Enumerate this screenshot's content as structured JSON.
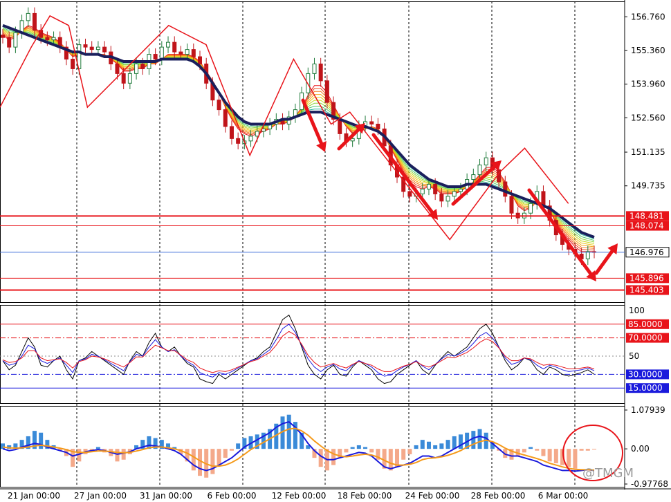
{
  "watermark": "@TMGM",
  "chart_data": {
    "type": "candlestick",
    "symbol": "",
    "x_labels": [
      "21 Jan 00:00",
      "27 Jan 00:00",
      "31 Jan 00:00",
      "6 Feb 00:00",
      "12 Feb 00:00",
      "18 Feb 00:00",
      "24 Feb 00:00",
      "28 Feb 00:00",
      "6 Mar 00:00"
    ],
    "price_panel": {
      "ylim": [
        144.9,
        157.4
      ],
      "tick_labels": [
        "156.760",
        "155.360",
        "153.960",
        "152.560",
        "151.135",
        "149.735"
      ],
      "tick_values": [
        156.76,
        155.36,
        153.96,
        152.56,
        151.135,
        149.735
      ],
      "levels": [
        {
          "label": "148.481",
          "value": 148.481,
          "color": "#e8141a",
          "thick": true
        },
        {
          "label": "148.074",
          "value": 148.074,
          "color": "#e8141a",
          "thick": false
        },
        {
          "label": "145.896",
          "value": 145.896,
          "color": "#e8141a",
          "thick": false
        },
        {
          "label": "145.403",
          "value": 145.403,
          "color": "#e8141a",
          "thick": true
        }
      ],
      "current_price": {
        "label": "146.976",
        "value": 146.976,
        "color": "#3f6fd8"
      },
      "close_series": [
        155.9,
        155.5,
        156.1,
        156.6,
        156.9,
        156.2,
        155.9,
        155.8,
        155.9,
        155.5,
        155.0,
        154.6,
        155.6,
        155.5,
        155.4,
        155.5,
        155.3,
        154.8,
        154.4,
        154.0,
        154.4,
        154.8,
        154.6,
        155.2,
        155.0,
        155.5,
        155.7,
        155.3,
        155.2,
        155.4,
        155.1,
        154.8,
        154.0,
        153.3,
        152.9,
        152.2,
        151.7,
        151.5,
        151.6,
        151.8,
        152.0,
        152.1,
        152.3,
        152.5,
        152.3,
        152.6,
        152.9,
        153.6,
        154.4,
        154.8,
        154.1,
        153.2,
        152.5,
        151.9,
        151.6,
        151.7,
        152.2,
        152.4,
        152.3,
        152.1,
        151.4,
        150.6,
        150.1,
        149.5,
        149.3,
        149.4,
        149.6,
        149.8,
        149.4,
        149.1,
        149.3,
        149.5,
        149.6,
        150.0,
        150.2,
        150.6,
        150.9,
        150.4,
        149.9,
        149.3,
        148.6,
        148.4,
        148.6,
        149.0,
        149.5,
        148.9,
        148.3,
        147.7,
        147.3,
        147.1,
        146.9,
        146.7,
        147.0,
        146.976
      ],
      "ema_fast": [
        156.0,
        155.8,
        155.9,
        156.2,
        156.4,
        156.3,
        156.1,
        156.0,
        155.9,
        155.7,
        155.4,
        155.1,
        155.2,
        155.2,
        155.2,
        155.2,
        155.2,
        155.0,
        154.8,
        154.5,
        154.5,
        154.6,
        154.6,
        154.8,
        154.8,
        155.0,
        155.2,
        155.2,
        155.2,
        155.2,
        155.1,
        154.9,
        154.5,
        154.1,
        153.6,
        153.0,
        152.5,
        152.1,
        151.9,
        151.8,
        151.9,
        152.0,
        152.1,
        152.3,
        152.3,
        152.4,
        152.6,
        153.0,
        153.5,
        153.9,
        153.9,
        153.6,
        153.1,
        152.6,
        152.2,
        151.9,
        152.0,
        152.1,
        152.2,
        152.1,
        151.8,
        151.3,
        150.8,
        150.3,
        149.9,
        149.7,
        149.6,
        149.7,
        149.6,
        149.4,
        149.4,
        149.4,
        149.5,
        149.7,
        149.9,
        150.2,
        150.5,
        150.5,
        150.3,
        149.9,
        149.4,
        148.9,
        148.7,
        148.8,
        149.1,
        149.0,
        148.7,
        148.2,
        147.8,
        147.5,
        147.2,
        147.0,
        147.0,
        147.0
      ],
      "ema_slow": [
        156.4,
        156.3,
        156.2,
        156.1,
        156.0,
        155.9,
        155.8,
        155.7,
        155.6,
        155.5,
        155.4,
        155.3,
        155.3,
        155.2,
        155.2,
        155.2,
        155.1,
        155.1,
        155.0,
        154.9,
        154.9,
        154.9,
        154.9,
        154.9,
        154.9,
        155.0,
        155.0,
        155.0,
        155.0,
        155.0,
        154.9,
        154.7,
        154.4,
        154.0,
        153.6,
        153.2,
        152.9,
        152.6,
        152.4,
        152.3,
        152.3,
        152.3,
        152.3,
        152.4,
        152.5,
        152.5,
        152.6,
        152.7,
        152.8,
        152.8,
        152.8,
        152.7,
        152.6,
        152.5,
        152.4,
        152.3,
        152.2,
        152.2,
        152.1,
        152.0,
        151.8,
        151.5,
        151.2,
        150.9,
        150.6,
        150.4,
        150.2,
        150.0,
        149.9,
        149.8,
        149.7,
        149.7,
        149.7,
        149.8,
        149.8,
        149.8,
        149.8,
        149.7,
        149.6,
        149.5,
        149.4,
        149.3,
        149.2,
        149.1,
        149.0,
        148.9,
        148.8,
        148.6,
        148.4,
        148.2,
        148.0,
        147.8,
        147.7,
        147.6
      ]
    },
    "rsi_panel": {
      "ylim": [
        0,
        100
      ],
      "top_label": "100",
      "mid_label": "50",
      "levels": [
        {
          "label": "85.0000",
          "value": 85,
          "color": "#e8141a"
        },
        {
          "label": "70.0000",
          "value": 70,
          "color": "#e8141a"
        },
        {
          "label": "30.0000",
          "value": 30,
          "color": "#1a1adc"
        },
        {
          "label": "15.0000",
          "value": 15,
          "color": "#1a1adc"
        }
      ],
      "series": [
        {
          "color": "#000000",
          "values": [
            45,
            35,
            40,
            55,
            70,
            60,
            40,
            38,
            45,
            50,
            35,
            25,
            45,
            48,
            55,
            50,
            45,
            40,
            35,
            30,
            45,
            55,
            50,
            65,
            75,
            60,
            55,
            60,
            50,
            42,
            38,
            25,
            22,
            20,
            30,
            25,
            30,
            35,
            40,
            45,
            48,
            55,
            60,
            75,
            90,
            95,
            80,
            60,
            40,
            30,
            25,
            35,
            40,
            30,
            28,
            38,
            45,
            40,
            35,
            25,
            20,
            22,
            30,
            35,
            40,
            45,
            35,
            30,
            40,
            48,
            55,
            50,
            55,
            60,
            70,
            80,
            85,
            75,
            60,
            45,
            35,
            40,
            48,
            45,
            35,
            30,
            38,
            35,
            30,
            28,
            30,
            32,
            35,
            30
          ]
        },
        {
          "color": "#1a1adc",
          "values": [
            45,
            40,
            42,
            50,
            62,
            58,
            45,
            42,
            45,
            48,
            40,
            32,
            45,
            47,
            52,
            50,
            46,
            42,
            38,
            34,
            44,
            52,
            50,
            60,
            68,
            60,
            55,
            57,
            50,
            44,
            40,
            32,
            29,
            27,
            32,
            30,
            33,
            37,
            41,
            45,
            47,
            52,
            57,
            68,
            80,
            85,
            76,
            62,
            47,
            38,
            33,
            38,
            41,
            36,
            34,
            40,
            45,
            42,
            38,
            32,
            28,
            29,
            34,
            38,
            41,
            45,
            39,
            35,
            41,
            47,
            52,
            50,
            53,
            57,
            64,
            72,
            76,
            70,
            60,
            48,
            41,
            43,
            48,
            46,
            40,
            36,
            40,
            38,
            35,
            33,
            34,
            35,
            37,
            34
          ]
        },
        {
          "color": "#e8141a",
          "values": [
            46,
            43,
            44,
            48,
            56,
            56,
            48,
            45,
            46,
            47,
            43,
            37,
            44,
            46,
            50,
            49,
            47,
            44,
            41,
            38,
            43,
            49,
            49,
            56,
            62,
            59,
            56,
            56,
            51,
            46,
            43,
            37,
            34,
            32,
            34,
            33,
            35,
            38,
            41,
            44,
            46,
            50,
            54,
            62,
            72,
            77,
            73,
            63,
            51,
            43,
            38,
            40,
            42,
            39,
            37,
            41,
            44,
            42,
            40,
            36,
            33,
            33,
            36,
            39,
            41,
            44,
            40,
            38,
            41,
            45,
            49,
            48,
            51,
            54,
            59,
            65,
            69,
            66,
            59,
            50,
            45,
            45,
            48,
            47,
            43,
            40,
            41,
            40,
            38,
            36,
            36,
            37,
            38,
            36
          ]
        }
      ]
    },
    "macd_panel": {
      "ylim": [
        -0.97768,
        1.07939
      ],
      "tick_labels": [
        "1.07939",
        "0.00",
        "-0.97768"
      ],
      "tick_values": [
        1.07939,
        0.0,
        -0.97768
      ],
      "histogram": [
        0.15,
        0.1,
        0.15,
        0.25,
        0.35,
        0.5,
        0.45,
        0.25,
        0.1,
        -0.05,
        -0.2,
        -0.5,
        -0.35,
        -0.15,
        -0.05,
        0.05,
        -0.1,
        -0.2,
        -0.35,
        -0.3,
        -0.15,
        0.1,
        0.25,
        0.35,
        0.3,
        0.25,
        0.15,
        0.05,
        -0.15,
        -0.35,
        -0.6,
        -0.75,
        -0.8,
        -0.7,
        -0.45,
        -0.25,
        -0.05,
        0.15,
        0.3,
        0.35,
        0.4,
        0.45,
        0.55,
        0.7,
        0.9,
        0.95,
        0.75,
        0.45,
        0.1,
        -0.25,
        -0.5,
        -0.6,
        -0.45,
        -0.25,
        -0.1,
        0.05,
        0.1,
        0.05,
        -0.1,
        -0.3,
        -0.55,
        -0.6,
        -0.5,
        -0.3,
        -0.15,
        0.1,
        0.25,
        0.2,
        0.1,
        0.15,
        0.25,
        0.35,
        0.4,
        0.45,
        0.5,
        0.55,
        0.45,
        0.2,
        -0.05,
        -0.25,
        -0.3,
        -0.2,
        -0.1,
        0.05,
        -0.05,
        -0.2,
        -0.35,
        -0.4,
        -0.45,
        -0.5,
        -0.55,
        -0.05,
        -0.05,
        -0.02
      ],
      "macd_line": [
        0.0,
        -0.05,
        -0.02,
        0.05,
        0.1,
        0.15,
        0.12,
        0.05,
        0.0,
        -0.05,
        -0.1,
        -0.2,
        -0.15,
        -0.08,
        -0.05,
        -0.02,
        -0.05,
        -0.1,
        -0.15,
        -0.12,
        -0.08,
        0.0,
        0.05,
        0.1,
        0.08,
        0.05,
        0.0,
        -0.05,
        -0.15,
        -0.3,
        -0.45,
        -0.55,
        -0.6,
        -0.55,
        -0.45,
        -0.35,
        -0.25,
        -0.1,
        0.05,
        0.15,
        0.25,
        0.35,
        0.45,
        0.6,
        0.7,
        0.75,
        0.6,
        0.4,
        0.15,
        -0.05,
        -0.2,
        -0.3,
        -0.3,
        -0.25,
        -0.2,
        -0.15,
        -0.1,
        -0.12,
        -0.2,
        -0.35,
        -0.5,
        -0.55,
        -0.5,
        -0.45,
        -0.4,
        -0.3,
        -0.2,
        -0.2,
        -0.25,
        -0.2,
        -0.1,
        0.0,
        0.1,
        0.2,
        0.3,
        0.35,
        0.3,
        0.15,
        0.0,
        -0.15,
        -0.2,
        -0.2,
        -0.25,
        -0.3,
        -0.35,
        -0.45,
        -0.5,
        -0.55,
        -0.6,
        -0.6,
        -0.62,
        -0.6,
        -0.58,
        -0.6
      ],
      "signal_line": [
        0.05,
        0.03,
        0.02,
        0.03,
        0.05,
        0.08,
        0.1,
        0.08,
        0.05,
        0.02,
        -0.02,
        -0.08,
        -0.1,
        -0.1,
        -0.08,
        -0.06,
        -0.06,
        -0.08,
        -0.1,
        -0.11,
        -0.1,
        -0.06,
        -0.02,
        0.03,
        0.05,
        0.05,
        0.03,
        0.0,
        -0.05,
        -0.12,
        -0.22,
        -0.33,
        -0.42,
        -0.48,
        -0.48,
        -0.45,
        -0.38,
        -0.28,
        -0.15,
        -0.02,
        0.08,
        0.18,
        0.28,
        0.38,
        0.48,
        0.55,
        0.57,
        0.5,
        0.38,
        0.22,
        0.08,
        -0.05,
        -0.14,
        -0.2,
        -0.22,
        -0.2,
        -0.17,
        -0.15,
        -0.17,
        -0.23,
        -0.32,
        -0.4,
        -0.45,
        -0.45,
        -0.43,
        -0.38,
        -0.3,
        -0.26,
        -0.25,
        -0.22,
        -0.18,
        -0.12,
        -0.05,
        0.05,
        0.13,
        0.2,
        0.24,
        0.2,
        0.12,
        0.02,
        -0.06,
        -0.12,
        -0.17,
        -0.22,
        -0.27,
        -0.33,
        -0.4,
        -0.45,
        -0.5,
        -0.54,
        -0.57,
        -0.58,
        -0.58,
        -0.59
      ]
    }
  }
}
